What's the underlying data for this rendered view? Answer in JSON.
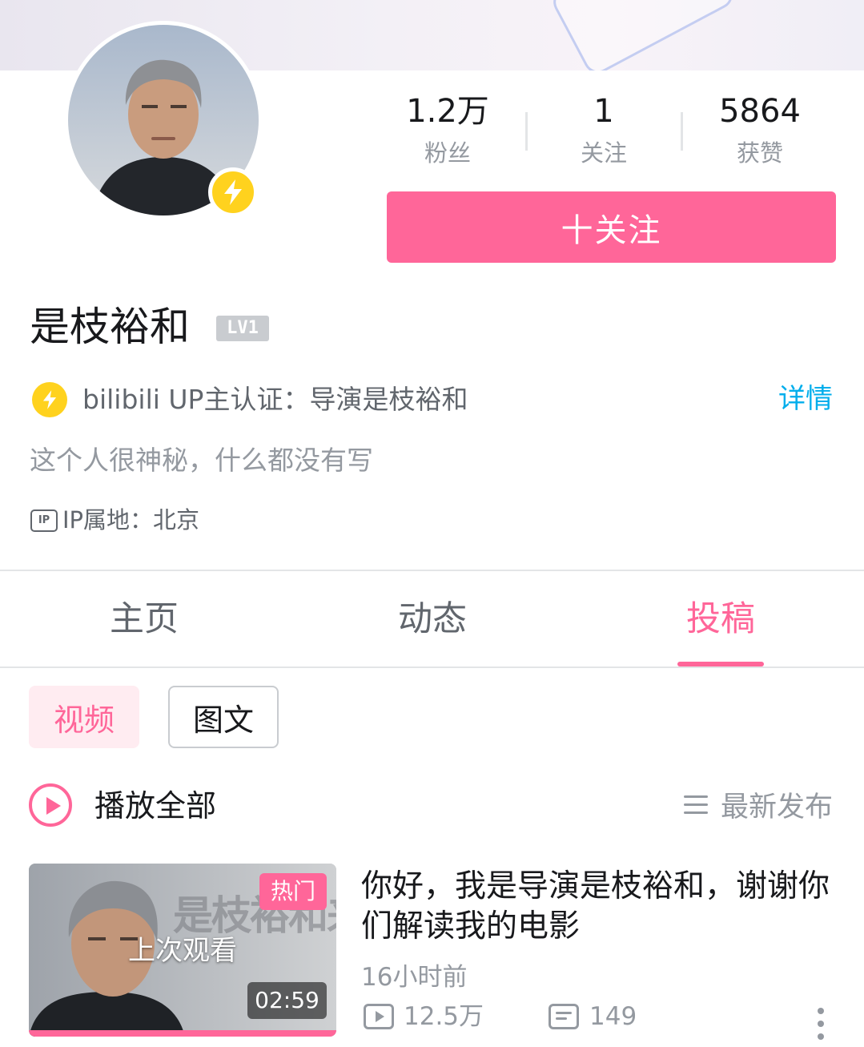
{
  "profile": {
    "stats": [
      {
        "value": "1.2万",
        "label": "粉丝"
      },
      {
        "value": "1",
        "label": "关注"
      },
      {
        "value": "5864",
        "label": "获赞"
      }
    ],
    "follow_label": "十关注",
    "username": "是枝裕和",
    "level": "LV1",
    "certification": "bilibili UP主认证：导演是枝裕和",
    "details_label": "详情",
    "bio": "这个人很神秘，什么都没有写",
    "ip_badge": "IP",
    "ip_location": "IP属地：北京"
  },
  "tabs": [
    {
      "label": "主页"
    },
    {
      "label": "动态"
    },
    {
      "label": "投稿",
      "active": true
    }
  ],
  "filters": [
    {
      "label": "视频",
      "active": true
    },
    {
      "label": "图文"
    }
  ],
  "list_header": {
    "play_all_label": "播放全部",
    "sort_label": "最新发布"
  },
  "video": {
    "hot_label": "热门",
    "last_watched_label": "上次观看",
    "duration": "02:59",
    "thumbnail_text": "是枝裕和来了",
    "title": "你好，我是导演是枝裕和，谢谢你们解读我的电影",
    "time_ago": "16小时前",
    "views": "12.5万",
    "danmaku": "149"
  },
  "colors": {
    "accent": "#ff6699",
    "link": "#00aeec",
    "badge": "#ffd21e"
  },
  "icons": [
    "lightning-icon",
    "ip-icon",
    "play-circle-icon",
    "sort-icon",
    "views-icon",
    "danmaku-icon",
    "more-icon"
  ]
}
